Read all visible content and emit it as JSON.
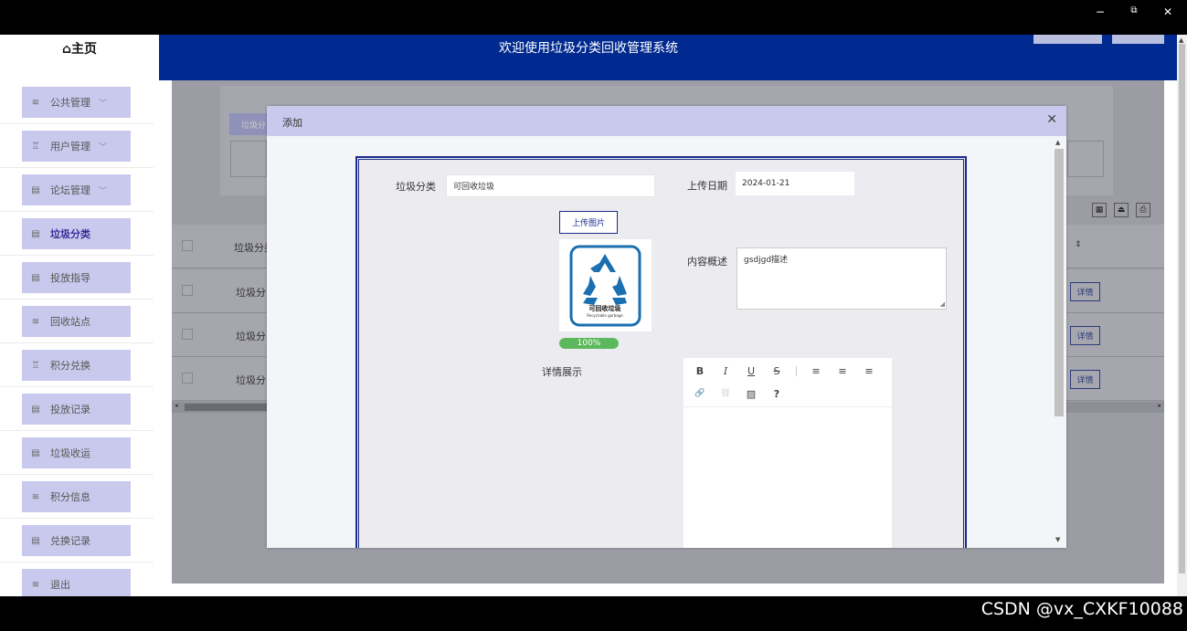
{
  "window": {
    "minimize": "−",
    "restore": "⧉",
    "close": "✕"
  },
  "sidebar": {
    "home_label": "⌂主页",
    "items": [
      {
        "label": "公共管理",
        "icon": "layers-icon",
        "glyph": "≋",
        "expandable": true
      },
      {
        "label": "用户管理",
        "icon": "user-icon",
        "glyph": "♖",
        "expandable": true
      },
      {
        "label": "论坛管理",
        "icon": "list-icon",
        "glyph": "▤",
        "expandable": true
      },
      {
        "label": "垃圾分类",
        "icon": "document-icon",
        "glyph": "▤",
        "expandable": false,
        "active": true
      },
      {
        "label": "投放指导",
        "icon": "list-icon",
        "glyph": "▤",
        "expandable": false
      },
      {
        "label": "回收站点",
        "icon": "layers-icon",
        "glyph": "≋",
        "expandable": false
      },
      {
        "label": "积分兑换",
        "icon": "user-icon",
        "glyph": "♖",
        "expandable": false
      },
      {
        "label": "投放记录",
        "icon": "list-icon",
        "glyph": "▤",
        "expandable": false
      },
      {
        "label": "垃圾收运",
        "icon": "document-icon",
        "glyph": "▤",
        "expandable": false
      },
      {
        "label": "积分信息",
        "icon": "layers-icon",
        "glyph": "≋",
        "expandable": false
      },
      {
        "label": "兑换记录",
        "icon": "list-icon",
        "glyph": "▤",
        "expandable": false
      },
      {
        "label": "退出",
        "icon": "layers-icon",
        "glyph": "≋",
        "expandable": false
      }
    ],
    "chevron": "﹀"
  },
  "header": {
    "title": "欢迎使用垃圾分类回收管理系统"
  },
  "background": {
    "tab_label": "垃圾分",
    "column_header": "垃圾分类",
    "rows": [
      "垃圾分",
      "垃圾分",
      "垃圾分"
    ],
    "detail_label": "详情",
    "sort_icon": "⇕",
    "tools": [
      "▦",
      "⏏",
      "⎙"
    ]
  },
  "dialog": {
    "title": "添加",
    "close": "✕",
    "category_label": "垃圾分类",
    "category_value": "可回收垃圾",
    "date_label": "上传日期",
    "date_value": "2024-01-21",
    "upload_button": "上传图片",
    "image": {
      "title": "可回收垃圾",
      "subtitle": "Recyclable garbage",
      "color": "#1a6fb0"
    },
    "progress": {
      "value": 100,
      "text": "100%"
    },
    "summary_label": "内容概述",
    "summary_value": "gsdjgd描述",
    "detail_label": "详情展示",
    "toolbar": {
      "bold": "B",
      "italic": "I",
      "underline": "U",
      "strike": "S",
      "align_left": "≡",
      "align_center": "≡",
      "align_right": "≡",
      "link": "🔗",
      "unlink": "⛓",
      "image": "▨",
      "help": "?"
    }
  },
  "watermark": "CSDN @vx_CXKF10088"
}
